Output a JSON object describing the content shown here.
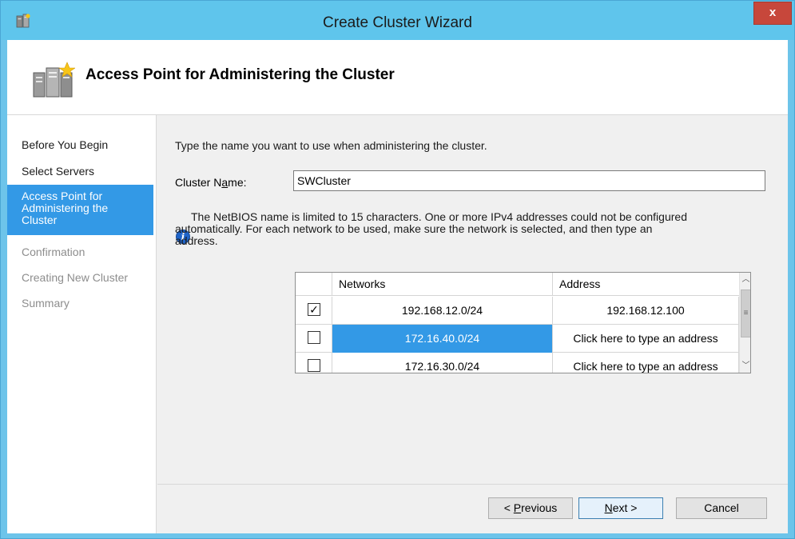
{
  "window": {
    "title": "Create Cluster Wizard",
    "close_label": "x"
  },
  "header": {
    "title": "Access Point for Administering the Cluster"
  },
  "nav": {
    "items": [
      {
        "label": "Before You Begin",
        "state": "normal"
      },
      {
        "label": "Select Servers",
        "state": "normal"
      },
      {
        "label": "Access Point for Administering the Cluster",
        "state": "selected"
      },
      {
        "label": "Confirmation",
        "state": "disabled"
      },
      {
        "label": "Creating New Cluster",
        "state": "disabled"
      },
      {
        "label": "Summary",
        "state": "disabled"
      }
    ]
  },
  "main": {
    "intro": "Type the name you want to use when administering the cluster.",
    "cluster_name_label_pre": "Cluster N",
    "cluster_name_label_accel": "a",
    "cluster_name_label_post": "me:",
    "cluster_name_value": "SWCluster",
    "notice_line1": "The NetBIOS name is limited to 15 characters.  One or more IPv4 addresses could not be configured",
    "notice_line2": "automatically.  For each network to be used, make sure the network is selected, and then type an",
    "notice_line3": "address."
  },
  "grid": {
    "headers": {
      "networks": "Networks",
      "address": "Address"
    },
    "rows": [
      {
        "checked": true,
        "network": "192.168.12.0/24",
        "address": "192.168.12.100",
        "selected": false
      },
      {
        "checked": false,
        "network": "172.16.40.0/24",
        "address": "Click here to type an address",
        "selected": true
      },
      {
        "checked": false,
        "network": "172.16.30.0/24",
        "address": "Click here to type an address",
        "selected": false
      }
    ]
  },
  "buttons": {
    "previous_pre": "< ",
    "previous_accel": "P",
    "previous_post": "revious",
    "next_accel": "N",
    "next_post": "ext >",
    "cancel": "Cancel"
  },
  "colors": {
    "titlebar": "#5fc5ec",
    "selection": "#3399e6",
    "close": "#c7473b",
    "info": "#1f64c8"
  }
}
